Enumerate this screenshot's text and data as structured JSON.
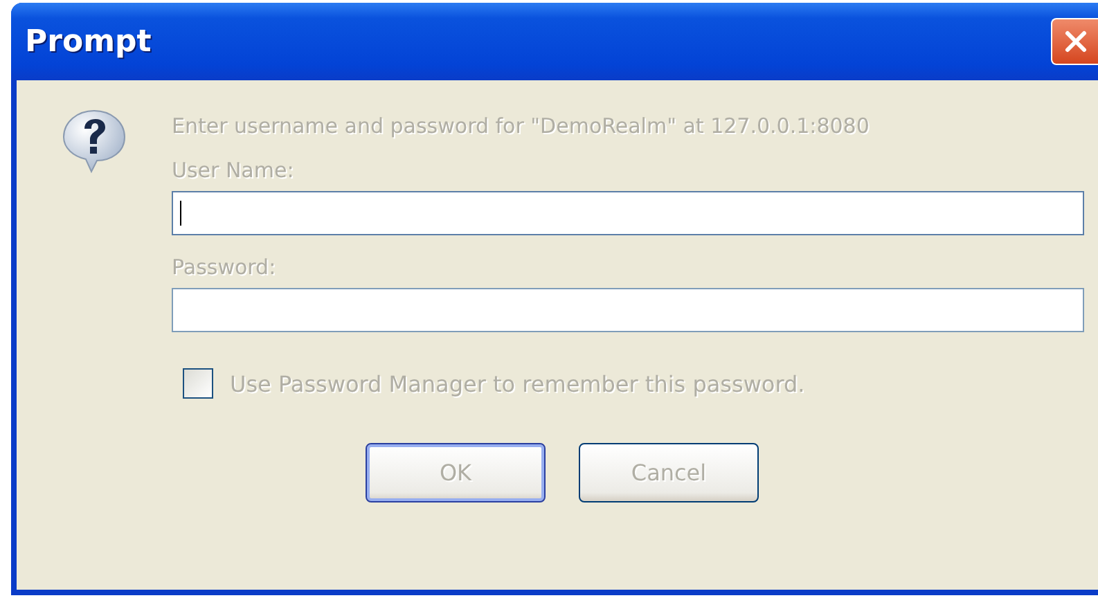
{
  "window": {
    "title": "Prompt"
  },
  "message": "Enter username and password for \"DemoRealm\" at 127.0.0.1:8080",
  "fields": [
    {
      "label": "User Name:",
      "focused": true
    },
    {
      "label": "Password:",
      "focused": false
    }
  ],
  "checkbox": {
    "label": "Use Password Manager to remember this password.",
    "checked": false
  },
  "buttons": [
    {
      "label": "OK",
      "default": true
    },
    {
      "label": "Cancel",
      "default": false
    }
  ]
}
